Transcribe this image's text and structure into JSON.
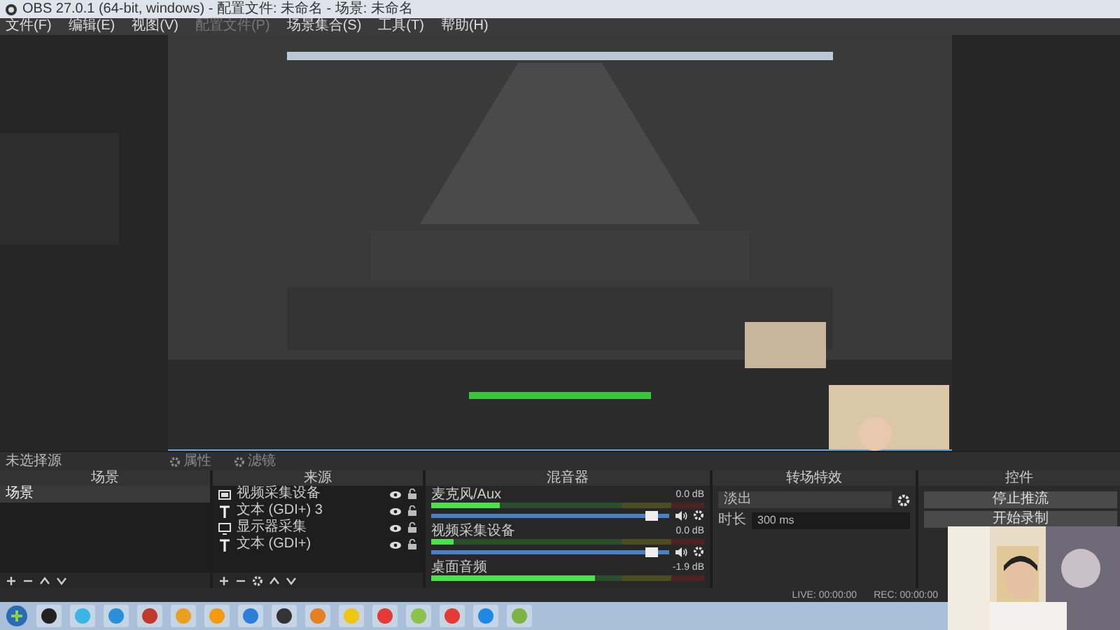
{
  "window": {
    "title": "OBS 27.0.1 (64-bit, windows) - 配置文件: 未命名 - 场景: 未命名"
  },
  "menu": [
    {
      "label": "文件(F)",
      "disabled": false
    },
    {
      "label": "编辑(E)",
      "disabled": false
    },
    {
      "label": "视图(V)",
      "disabled": false
    },
    {
      "label": "配置文件(P)",
      "disabled": true
    },
    {
      "label": "场景集合(S)",
      "disabled": false
    },
    {
      "label": "工具(T)",
      "disabled": false
    },
    {
      "label": "帮助(H)",
      "disabled": false
    }
  ],
  "source_toolbar": {
    "label": "未选择源",
    "buttons": [
      {
        "label": "属性",
        "disabled": true
      },
      {
        "label": "滤镜",
        "disabled": true
      }
    ]
  },
  "scenes": {
    "title": "场景",
    "items": [
      {
        "label": "场景",
        "selected": true
      }
    ]
  },
  "sources": {
    "title": "来源",
    "items": [
      {
        "label": "视频采集设备",
        "kind": "camera",
        "visible": true,
        "locked": false
      },
      {
        "label": "文本 (GDI+) 3",
        "kind": "text",
        "visible": true,
        "locked": false
      },
      {
        "label": "显示器采集",
        "kind": "monitor",
        "visible": true,
        "locked": false
      },
      {
        "label": "文本 (GDI+)",
        "kind": "text",
        "visible": true,
        "locked": false
      }
    ]
  },
  "mixer": {
    "title": "混音器",
    "channels": [
      {
        "name": "麦克风/Aux",
        "reading": "0.0 dB",
        "level": 0.25,
        "volume": {
          "level": 0.95
        },
        "muted": false
      },
      {
        "name": "视频采集设备",
        "reading": "0.0 dB",
        "level": 0.08,
        "volume": {
          "level": 0.95
        },
        "muted": false
      },
      {
        "name": "桌面音频",
        "reading": "-1.9 dB",
        "level": 0.6
      }
    ]
  },
  "transitions": {
    "title": "转场特效",
    "transition": "淡出",
    "duration_label": "时长",
    "duration": "300 ms"
  },
  "controls": {
    "title": "控件",
    "buttons": [
      "停止推流",
      "开始录制"
    ]
  },
  "status_bar": {
    "live": "LIVE: 00:00:00",
    "rec": "REC: 00:00:00"
  }
}
